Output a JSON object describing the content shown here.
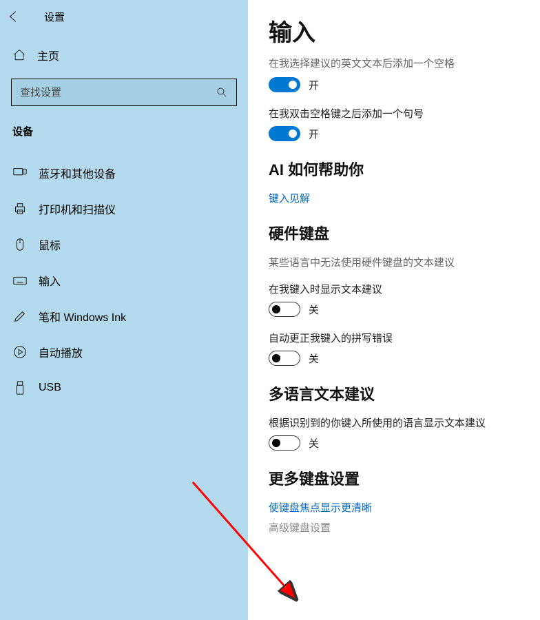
{
  "header": {
    "settings_label": "设置"
  },
  "sidebar": {
    "home_label": "主页",
    "search_placeholder": "查找设置",
    "category": "设备",
    "items": [
      {
        "id": "bluetooth",
        "label": "蓝牙和其他设备"
      },
      {
        "id": "printers",
        "label": "打印机和扫描仪"
      },
      {
        "id": "mouse",
        "label": "鼠标"
      },
      {
        "id": "typing",
        "label": "输入"
      },
      {
        "id": "pen",
        "label": "笔和 Windows Ink"
      },
      {
        "id": "autoplay",
        "label": "自动播放"
      },
      {
        "id": "usb",
        "label": "USB"
      }
    ]
  },
  "main": {
    "title": "输入",
    "truncated": "在我选择建议的英文文本后添加一个空格",
    "toggle1": {
      "state": "on",
      "label": "开"
    },
    "desc2": "在我双击空格键之后添加一个句号",
    "toggle2": {
      "state": "on",
      "label": "开"
    },
    "ai_section": "AI 如何帮助你",
    "ai_link": "键入见解",
    "hw_section": "硬件键盘",
    "hw_subdesc": "某些语言中无法使用硬件键盘的文本建议",
    "desc3": "在我键入时显示文本建议",
    "toggle3": {
      "state": "off",
      "label": "关"
    },
    "desc4": "自动更正我键入的拼写错误",
    "toggle4": {
      "state": "off",
      "label": "关"
    },
    "multi_section": "多语言文本建议",
    "multi_desc": "根据识别到的你键入所使用的语言显示文本建议",
    "toggle5": {
      "state": "off",
      "label": "关"
    },
    "more_section": "更多键盘设置",
    "link1": "使键盘焦点显示更清晰",
    "link2": "高级键盘设置"
  }
}
